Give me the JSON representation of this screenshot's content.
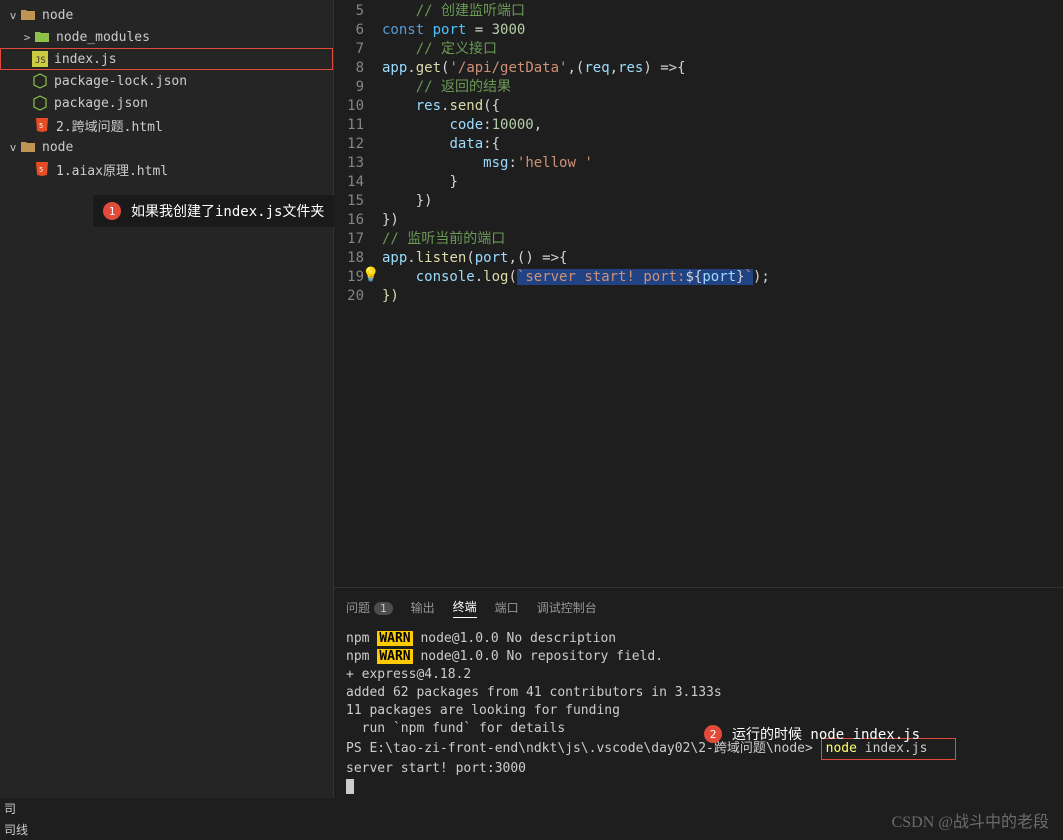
{
  "sidebar": {
    "root1": {
      "name": "node",
      "chev": "v"
    },
    "items1": [
      {
        "chev": ">",
        "icon": "folder-green",
        "label": "node_modules"
      },
      {
        "chev": "",
        "icon": "js",
        "label": "index.js"
      },
      {
        "chev": "",
        "icon": "npm",
        "label": "package-lock.json"
      },
      {
        "chev": "",
        "icon": "npm",
        "label": "package.json"
      },
      {
        "chev": "",
        "icon": "html",
        "label": "2.跨域问题.html"
      }
    ],
    "root2": {
      "name": "node",
      "chev": "v"
    },
    "items2": [
      {
        "chev": "",
        "icon": "html",
        "label": "1.aiax原理.html"
      }
    ]
  },
  "annotation1": {
    "num": "1",
    "text": "如果我创建了index.js文件夹"
  },
  "annotation2": {
    "num": "2",
    "text": "运行的时候 node index.js"
  },
  "code": {
    "lines": [
      {
        "n": "5",
        "raw": "    // 创建监听端口"
      },
      {
        "n": "6",
        "raw": "const port = 3000"
      },
      {
        "n": "7",
        "raw": "    // 定义接口"
      },
      {
        "n": "8",
        "raw": "app.get('/api/getData',(req,res) =>{"
      },
      {
        "n": "9",
        "raw": "    // 返回的结果"
      },
      {
        "n": "10",
        "raw": "    res.send({"
      },
      {
        "n": "11",
        "raw": "        code:10000,"
      },
      {
        "n": "12",
        "raw": "        data:{"
      },
      {
        "n": "13",
        "raw": "            msg:'hellow '"
      },
      {
        "n": "14",
        "raw": "        }"
      },
      {
        "n": "15",
        "raw": "    })"
      },
      {
        "n": "16",
        "raw": "})"
      },
      {
        "n": "17",
        "raw": "// 监听当前的端口"
      },
      {
        "n": "18",
        "raw": "app.listen(port,() =>{"
      },
      {
        "n": "19",
        "raw": "    console.log(`server start! port:${port}`);"
      },
      {
        "n": "20",
        "raw": "})"
      }
    ]
  },
  "panel": {
    "tabs": {
      "problems": "问题",
      "problems_count": "1",
      "output": "输出",
      "terminal": "终端",
      "ports": "端口",
      "debug": "调试控制台"
    }
  },
  "terminal": {
    "l1a": "npm ",
    "l1w": "WARN",
    "l1b": " node@1.0.0 No description",
    "l2a": "npm ",
    "l2w": "WARN",
    "l2b": " node@1.0.0 No repository field.",
    "l3": "",
    "l4": "+ express@4.18.2",
    "l5": "added 62 packages from 41 contributors in 3.133s",
    "l6": "",
    "l7": "11 packages are looking for funding",
    "l8": "  run `npm fund` for details",
    "l9": "",
    "prompt": "PS E:\\tao-zi-front-end\\ndkt\\js\\.vscode\\day02\\2-跨域问题\\node> ",
    "cmd_y": "node ",
    "cmd_r": "index.js",
    "result": "server start! port:3000"
  },
  "status": {
    "l1": "司",
    "l2": "司线"
  },
  "watermark": "CSDN @战斗中的老段"
}
